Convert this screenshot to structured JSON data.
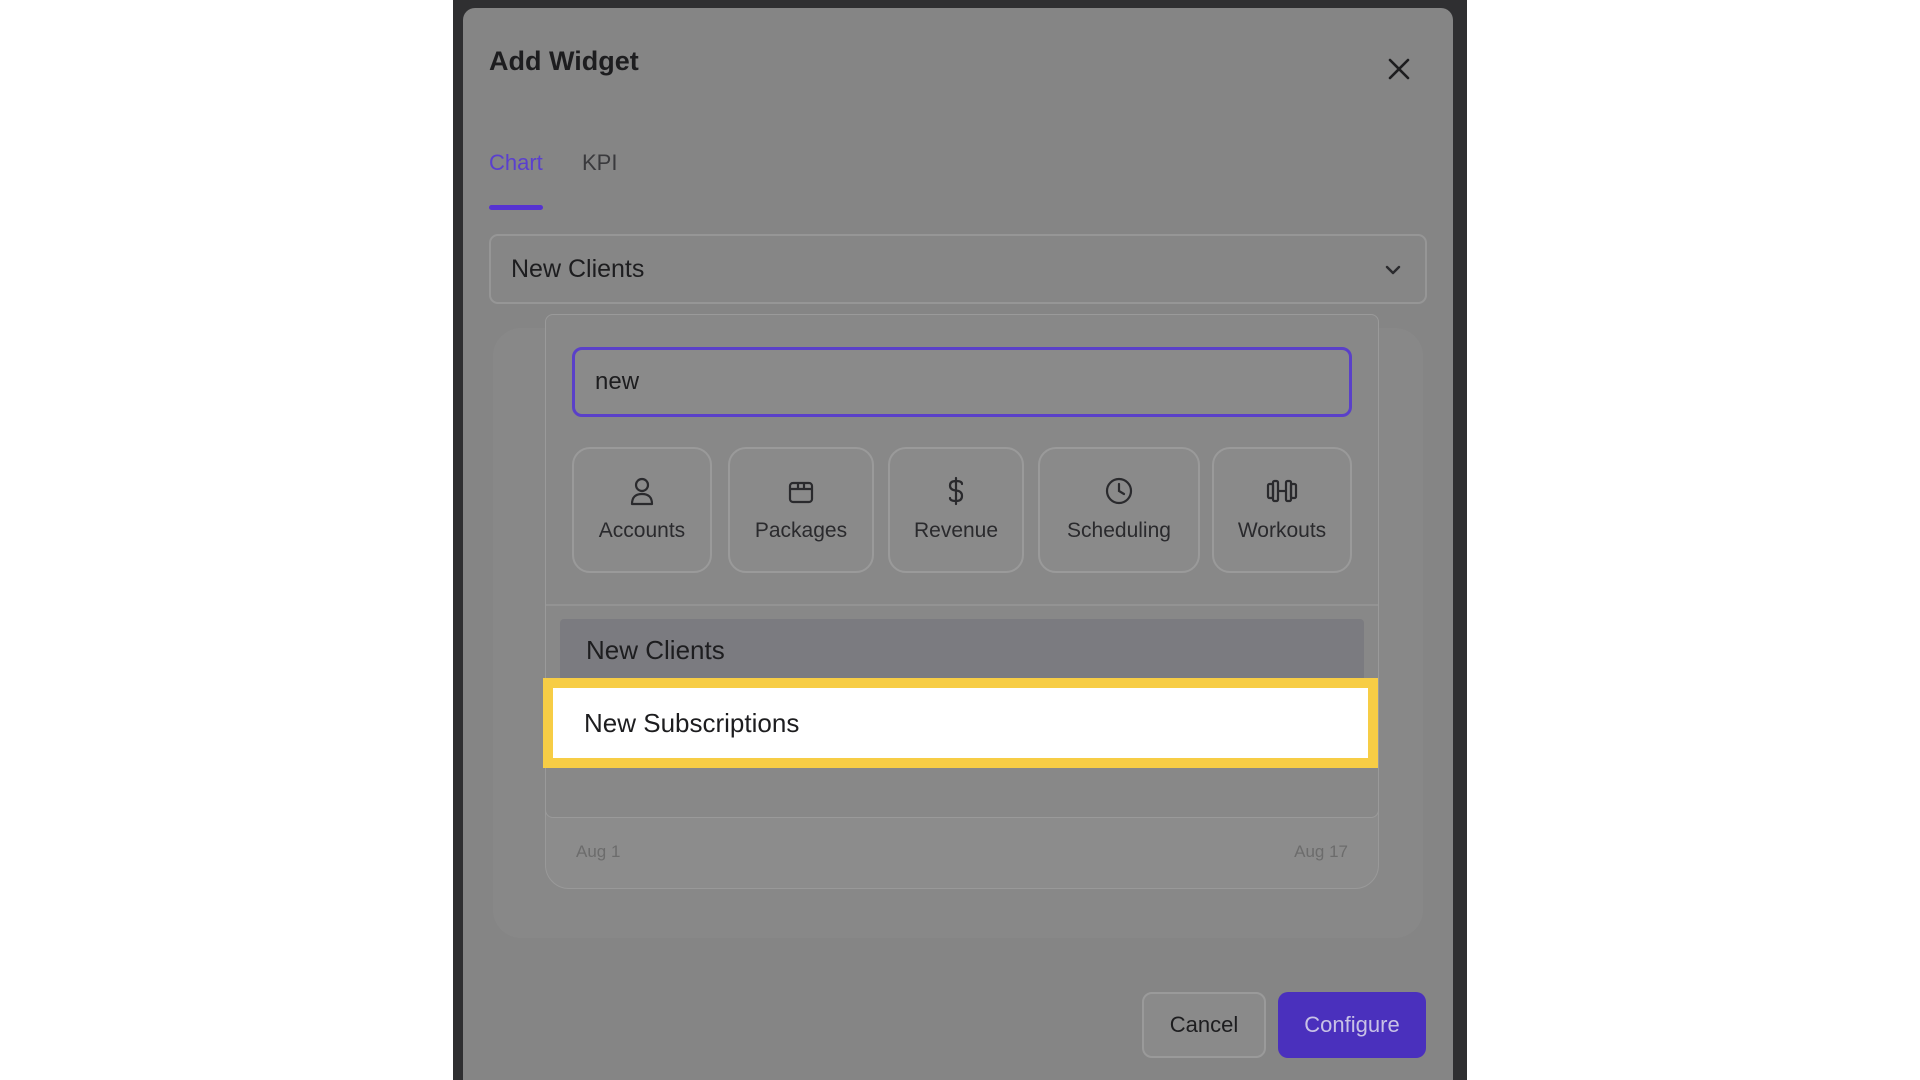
{
  "modal": {
    "title": "Add Widget",
    "close_icon": "close-icon",
    "tabs": [
      {
        "label": "Chart",
        "active": true
      },
      {
        "label": "KPI",
        "active": false
      }
    ],
    "metric_select": {
      "value": "New Clients",
      "icon": "chevron-down-icon"
    },
    "dropdown": {
      "search_value": "new",
      "categories": [
        {
          "label": "Accounts",
          "icon": "user-icon"
        },
        {
          "label": "Packages",
          "icon": "package-icon"
        },
        {
          "label": "Revenue",
          "icon": "dollar-icon"
        },
        {
          "label": "Scheduling",
          "icon": "clock-icon"
        },
        {
          "label": "Workouts",
          "icon": "dumbbell-icon"
        }
      ],
      "results": [
        {
          "label": "New Clients",
          "state": "hovered"
        },
        {
          "label": "New Subscriptions",
          "state": "highlighted"
        }
      ]
    },
    "chart_preview": {
      "x_start_label": "Aug 1",
      "x_end_label": "Aug 17"
    },
    "buttons": {
      "cancel_label": "Cancel",
      "configure_label": "Configure"
    }
  },
  "colors": {
    "accent": "#5633d1",
    "highlight": "#f7cd45",
    "overlay": "#858585"
  }
}
